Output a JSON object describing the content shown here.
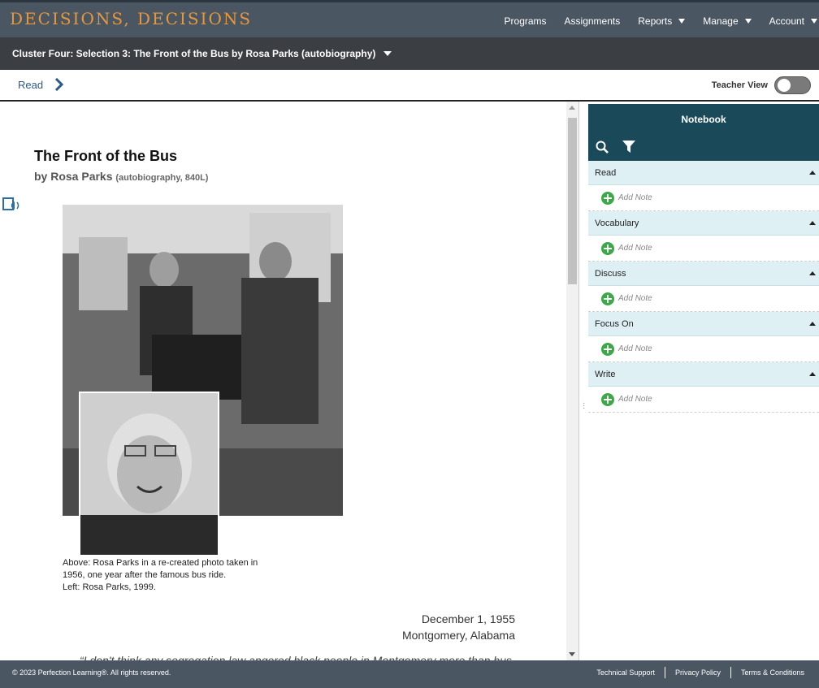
{
  "header": {
    "logo": "DECISIONS, DECISIONS",
    "nav": [
      "Programs",
      "Assignments",
      "Reports",
      "Manage",
      "Account"
    ]
  },
  "subbar": {
    "title": "Cluster Four: Selection 3: The Front of the Bus by Rosa Parks (autobiography)"
  },
  "tabbar": {
    "read_label": "Read",
    "teacher_view_label": "Teacher View"
  },
  "story": {
    "title": "The Front of the Bus",
    "author": "by Rosa Parks",
    "meta": "(autobiography, 840L)",
    "caption": [
      "Above: Rosa Parks in a re-created photo taken in",
      "1956, one year after the famous bus ride.",
      "Left: Rosa Parks, 1999."
    ],
    "date": "December 1, 1955",
    "place": "Montgomery, Alabama",
    "partial_line": "“I don't think any segregation law angered black people in Montgomery more than bus"
  },
  "notebook": {
    "title": "Notebook",
    "add_note_label": "Add Note",
    "sections": [
      "Read",
      "Vocabulary",
      "Discuss",
      "Focus On",
      "Write"
    ]
  },
  "footer": {
    "copyright": "© 2023 Perfection Learning®. All rights reserved.",
    "links": [
      "Technical Support",
      "Privacy Policy",
      "Terms & Conditions"
    ]
  }
}
